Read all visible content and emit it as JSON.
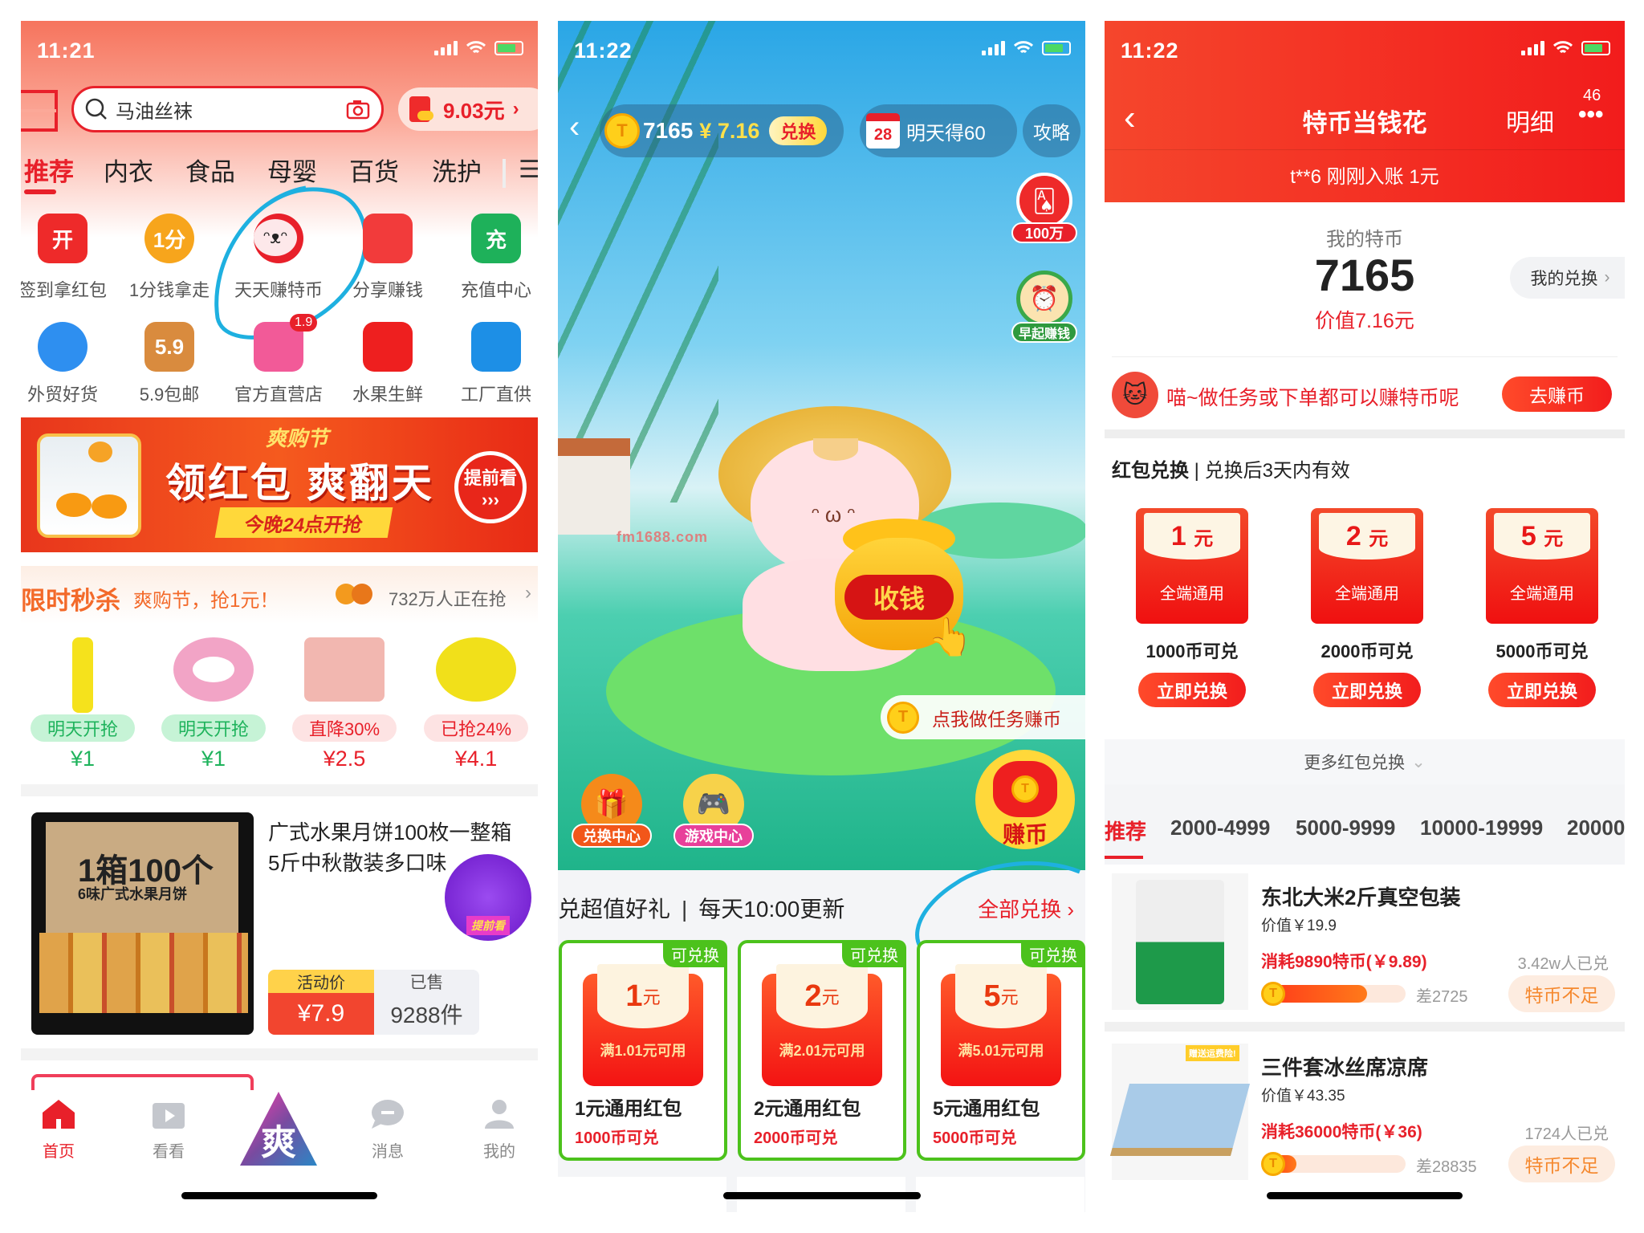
{
  "colors": {
    "brand_red": "#e8202a",
    "green": "#29c27c",
    "annotation_blue": "#1eb0e0",
    "orange": "#f5892f"
  },
  "home": {
    "status": {
      "time": "11:21"
    },
    "search": {
      "placeholder": "马油丝袜",
      "icon": "search-icon"
    },
    "balance": "9.03元",
    "tabs": [
      "推荐",
      "内衣",
      "食品",
      "母婴",
      "百货",
      "洗护"
    ],
    "active_tab": "推荐",
    "grid": [
      {
        "label": "签到拿红包",
        "glyph": "开",
        "color": "#ee2a2a"
      },
      {
        "label": "1分钱拿走",
        "glyph": "1分",
        "color": "#f7a51c"
      },
      {
        "label": "天天赚特币",
        "glyph": "",
        "color": "#e8202a"
      },
      {
        "label": "分享赚钱",
        "glyph": "",
        "color": "#f23b3b"
      },
      {
        "label": "充值中心",
        "glyph": "充",
        "color": "#1eb15a"
      },
      {
        "label": "外贸好货",
        "glyph": "",
        "color": "#2e8ff0"
      },
      {
        "label": "5.9包邮",
        "glyph": "5.9",
        "color": "#d98b3e"
      },
      {
        "label": "官方直营店",
        "glyph": "",
        "color": "#f25a98",
        "badge": "1.9"
      },
      {
        "label": "水果生鲜",
        "glyph": "",
        "color": "#ee1f1f"
      },
      {
        "label": "工厂直供",
        "glyph": "",
        "color": "#1d8fe6"
      }
    ],
    "banner": {
      "festival": "爽购节",
      "headline": "领红包 爽翻天",
      "sub": "今晚24点开抢",
      "cta": "提前看"
    },
    "flash": {
      "title": "限时秒杀",
      "subtitle": "爽购节，抢1元！",
      "count": "732万人正在抢",
      "items": [
        {
          "tag": "明天开抢",
          "price": "¥1",
          "tone": "green"
        },
        {
          "tag": "明天开抢",
          "price": "¥1",
          "tone": "green"
        },
        {
          "tag": "直降30%",
          "price": "¥2.5",
          "tone": "red"
        },
        {
          "tag": "已抢24%",
          "price": "¥4.1",
          "tone": "red"
        }
      ]
    },
    "product": {
      "title": "广式水果月饼100枚一整箱5斤中秋散装多口味",
      "image_line1": "1箱100个",
      "image_line2": "6味广式水果月饼",
      "badge": "提前看",
      "price_label": "活动价",
      "price": "¥7.9",
      "sold_label": "已售",
      "sold": "9288件"
    },
    "tabbar": [
      {
        "label": "首页",
        "icon": "home-icon",
        "active": true
      },
      {
        "label": "看看",
        "icon": "video-icon",
        "active": false
      },
      {
        "label": "",
        "icon": "shuang-logo-icon",
        "active": false
      },
      {
        "label": "消息",
        "icon": "message-icon",
        "active": false
      },
      {
        "label": "我的",
        "icon": "user-icon",
        "active": false
      }
    ]
  },
  "game": {
    "status": {
      "time": "11:22"
    },
    "coins": "7165",
    "value": "¥ 7.16",
    "exchange_btn": "兑换",
    "calendar_day": "28",
    "tomorrow": "明天得60",
    "guide": "攻略",
    "side": [
      {
        "label": "100万",
        "icon": "cards-icon"
      },
      {
        "label": "早起赚钱",
        "icon": "alarm-clock-icon"
      }
    ],
    "watermark": "fm1688.com",
    "collect": "收钱",
    "task_bubble": "点我做任务赚币",
    "earn_btn": "赚币",
    "bottom_btns": [
      {
        "label": "兑换中心",
        "icon": "treasure-chest-icon"
      },
      {
        "label": "游戏中心",
        "icon": "gamepad-icon"
      }
    ],
    "section_title": "兑超值好礼",
    "section_sub": "每天10:00更新",
    "all_link": "全部兑换",
    "cards": [
      {
        "badge": "可兑换",
        "amount": "1",
        "unit": "元",
        "cond": "满1.01元可用",
        "name": "1元通用红包",
        "cost": "1000币可兑"
      },
      {
        "badge": "可兑换",
        "amount": "2",
        "unit": "元",
        "cond": "满2.01元可用",
        "name": "2元通用红包",
        "cost": "2000币可兑"
      },
      {
        "badge": "可兑换",
        "amount": "5",
        "unit": "元",
        "cond": "满5.01元可用",
        "name": "5元通用红包",
        "cost": "5000币可兑"
      }
    ]
  },
  "exchange": {
    "status": {
      "time": "11:22"
    },
    "title": "特币当钱花",
    "detail": "明细",
    "badge": "46",
    "ticker": "t**6 刚刚入账 1元",
    "my_label": "我的特币",
    "my_coins": "7165",
    "my_value": "价值7.16元",
    "my_exchange": "我的兑换",
    "tip": "喵~做任务或下单都可以赚特币呢",
    "earn_btn": "去赚币",
    "rp_title": "红包兑换",
    "rp_sub": "兑换后3天内有效",
    "vouchers": [
      {
        "amount": "1",
        "unit": "元",
        "scope": "全端通用",
        "cost": "1000币可兑",
        "btn": "立即兑换"
      },
      {
        "amount": "2",
        "unit": "元",
        "scope": "全端通用",
        "cost": "2000币可兑",
        "btn": "立即兑换"
      },
      {
        "amount": "5",
        "unit": "元",
        "scope": "全端通用",
        "cost": "5000币可兑",
        "btn": "立即兑换"
      }
    ],
    "more": "更多红包兑换",
    "tabs": [
      "推荐",
      "2000-4999",
      "5000-9999",
      "10000-19999",
      "20000"
    ],
    "items": [
      {
        "title": "东北大米2斤真空包装",
        "value": "价值￥19.9",
        "cost": "消耗9890特币(￥9.89)",
        "redeemed": "3.42w人已兑",
        "progress": 0.72,
        "short": "差2725",
        "btn": "特币不足"
      },
      {
        "title": "三件套冰丝席凉席",
        "value": "价值￥43.35",
        "cost": "消耗36000特币(￥36)",
        "redeemed": "1724人已兑",
        "progress": 0.2,
        "short": "差28835",
        "btn": "特币不足",
        "img_badge": "赠送运费险!"
      }
    ]
  }
}
